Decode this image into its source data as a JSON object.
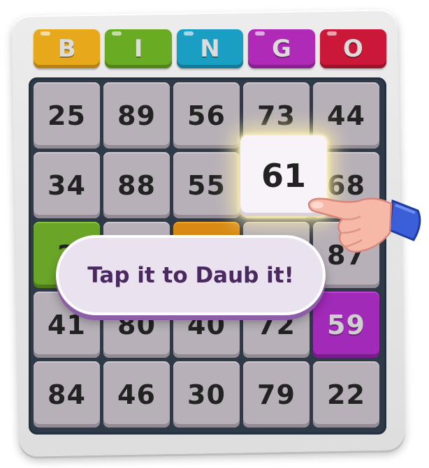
{
  "header": {
    "letters": [
      {
        "label": "B",
        "color": "#e8a81c"
      },
      {
        "label": "I",
        "color": "#6aab24"
      },
      {
        "label": "N",
        "color": "#1b9ec4"
      },
      {
        "label": "G",
        "color": "#b02ab8"
      },
      {
        "label": "O",
        "color": "#cc1838"
      }
    ]
  },
  "grid": {
    "rows": [
      [
        {
          "value": "25",
          "state": "normal"
        },
        {
          "value": "89",
          "state": "normal"
        },
        {
          "value": "56",
          "state": "normal"
        },
        {
          "value": "73",
          "state": "normal"
        },
        {
          "value": "44",
          "state": "normal"
        }
      ],
      [
        {
          "value": "34",
          "state": "normal"
        },
        {
          "value": "88",
          "state": "normal"
        },
        {
          "value": "55",
          "state": "normal"
        },
        {
          "value": "",
          "state": "highlight-base"
        },
        {
          "value": "68",
          "state": "normal"
        }
      ],
      [
        {
          "value": "2",
          "state": "daubed-green"
        },
        {
          "value": "",
          "state": "normal"
        },
        {
          "value": "",
          "state": "daubed-orange"
        },
        {
          "value": "",
          "state": "normal"
        },
        {
          "value": "87",
          "state": "normal"
        }
      ],
      [
        {
          "value": "41",
          "state": "normal"
        },
        {
          "value": "80",
          "state": "normal"
        },
        {
          "value": "40",
          "state": "normal"
        },
        {
          "value": "72",
          "state": "normal"
        },
        {
          "value": "59",
          "state": "daubed-purple"
        }
      ],
      [
        {
          "value": "84",
          "state": "normal"
        },
        {
          "value": "46",
          "state": "normal"
        },
        {
          "value": "30",
          "state": "normal"
        },
        {
          "value": "79",
          "state": "normal"
        },
        {
          "value": "22",
          "state": "normal"
        }
      ]
    ]
  },
  "highlight": {
    "value": "61"
  },
  "tooltip": {
    "text": "Tap it to Daub it!"
  },
  "icons": {
    "hand": "pointing-hand-icon"
  }
}
